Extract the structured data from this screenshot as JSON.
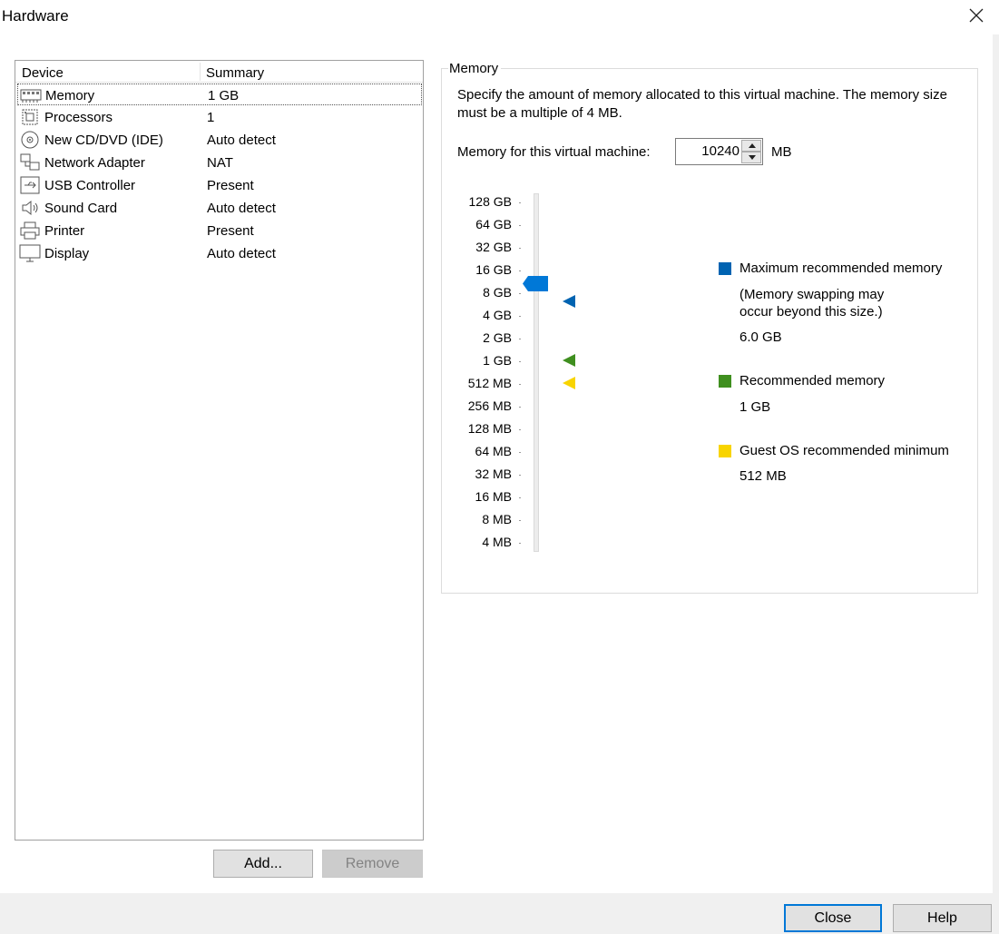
{
  "window": {
    "title": "Hardware"
  },
  "devices": {
    "header_device": "Device",
    "header_summary": "Summary",
    "items": [
      {
        "name": "Memory",
        "summary": "1 GB",
        "icon": "memory-icon"
      },
      {
        "name": "Processors",
        "summary": "1",
        "icon": "processor-icon"
      },
      {
        "name": "New CD/DVD (IDE)",
        "summary": "Auto detect",
        "icon": "cd-dvd-icon"
      },
      {
        "name": "Network Adapter",
        "summary": "NAT",
        "icon": "network-icon"
      },
      {
        "name": "USB Controller",
        "summary": "Present",
        "icon": "usb-icon"
      },
      {
        "name": "Sound Card",
        "summary": "Auto detect",
        "icon": "sound-icon"
      },
      {
        "name": "Printer",
        "summary": "Present",
        "icon": "printer-icon"
      },
      {
        "name": "Display",
        "summary": "Auto detect",
        "icon": "display-icon"
      }
    ],
    "selected": "Memory",
    "add_label": "Add...",
    "remove_label": "Remove"
  },
  "memory": {
    "group_label": "Memory",
    "description": "Specify the amount of memory allocated to this virtual machine. The memory size must be a multiple of 4 MB.",
    "field_label": "Memory for this virtual machine:",
    "value": "10240",
    "unit": "MB",
    "scale_labels": [
      "128 GB",
      "64 GB",
      "32 GB",
      "16 GB",
      "8 GB",
      "4 GB",
      "2 GB",
      "1 GB",
      "512 MB",
      "256 MB",
      "128 MB",
      "64 MB",
      "32 MB",
      "16 MB",
      "8 MB",
      "4 MB"
    ],
    "legend": {
      "max_label": "Maximum recommended memory",
      "max_note_1": "(Memory swapping may",
      "max_note_2": "occur beyond this size.)",
      "max_value": "6.0 GB",
      "rec_label": "Recommended memory",
      "rec_value": "1 GB",
      "min_label": "Guest OS recommended minimum",
      "min_value": "512 MB"
    },
    "colors": {
      "max": "#0063b1",
      "recommended": "#3f8f1f",
      "minimum": "#f8d400",
      "thumb": "#0078d7"
    }
  },
  "footer": {
    "close_label": "Close",
    "help_label": "Help"
  }
}
